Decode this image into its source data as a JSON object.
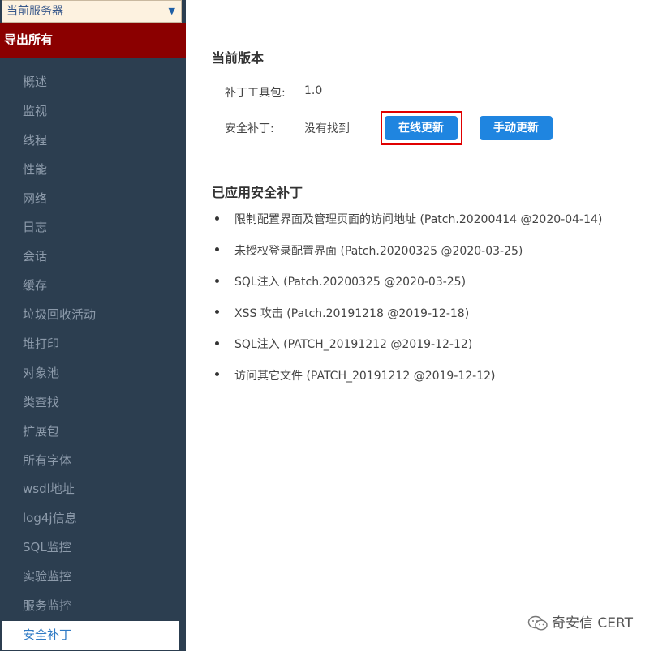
{
  "sidebar": {
    "server_select": "当前服务器",
    "export_all": "导出所有",
    "items": [
      {
        "label": "概述"
      },
      {
        "label": "监视"
      },
      {
        "label": "线程"
      },
      {
        "label": "性能"
      },
      {
        "label": "网络"
      },
      {
        "label": "日志"
      },
      {
        "label": "会话"
      },
      {
        "label": "缓存"
      },
      {
        "label": "垃圾回收活动"
      },
      {
        "label": "堆打印"
      },
      {
        "label": "对象池"
      },
      {
        "label": "类查找"
      },
      {
        "label": "扩展包"
      },
      {
        "label": "所有字体"
      },
      {
        "label": "wsdl地址"
      },
      {
        "label": "log4j信息"
      },
      {
        "label": "SQL监控"
      },
      {
        "label": "实验监控"
      },
      {
        "label": "服务监控"
      },
      {
        "label": "安全补丁",
        "active": true
      }
    ]
  },
  "main": {
    "current_version_heading": "当前版本",
    "patch_tool_label": "补丁工具包:",
    "patch_tool_value": "1.0",
    "security_patch_label": "安全补丁:",
    "security_patch_value": "没有找到",
    "online_update_button": "在线更新",
    "manual_update_button": "手动更新",
    "applied_heading": "已应用安全补丁",
    "applied_patches": [
      "限制配置界面及管理页面的访问地址 (Patch.20200414 @2020-04-14)",
      "未授权登录配置界面 (Patch.20200325 @2020-03-25)",
      "SQL注入 (Patch.20200325 @2020-03-25)",
      "XSS 攻击 (Patch.20191218 @2019-12-18)",
      "SQL注入 (PATCH_20191212 @2019-12-12)",
      "访问其它文件 (PATCH_20191212 @2019-12-12)"
    ]
  },
  "watermark": "奇安信 CERT",
  "colors": {
    "sidebar_bg": "#2c3e50",
    "export_bg": "#8b0000",
    "button_bg": "#1f85e0",
    "highlight_border": "#e00000"
  }
}
